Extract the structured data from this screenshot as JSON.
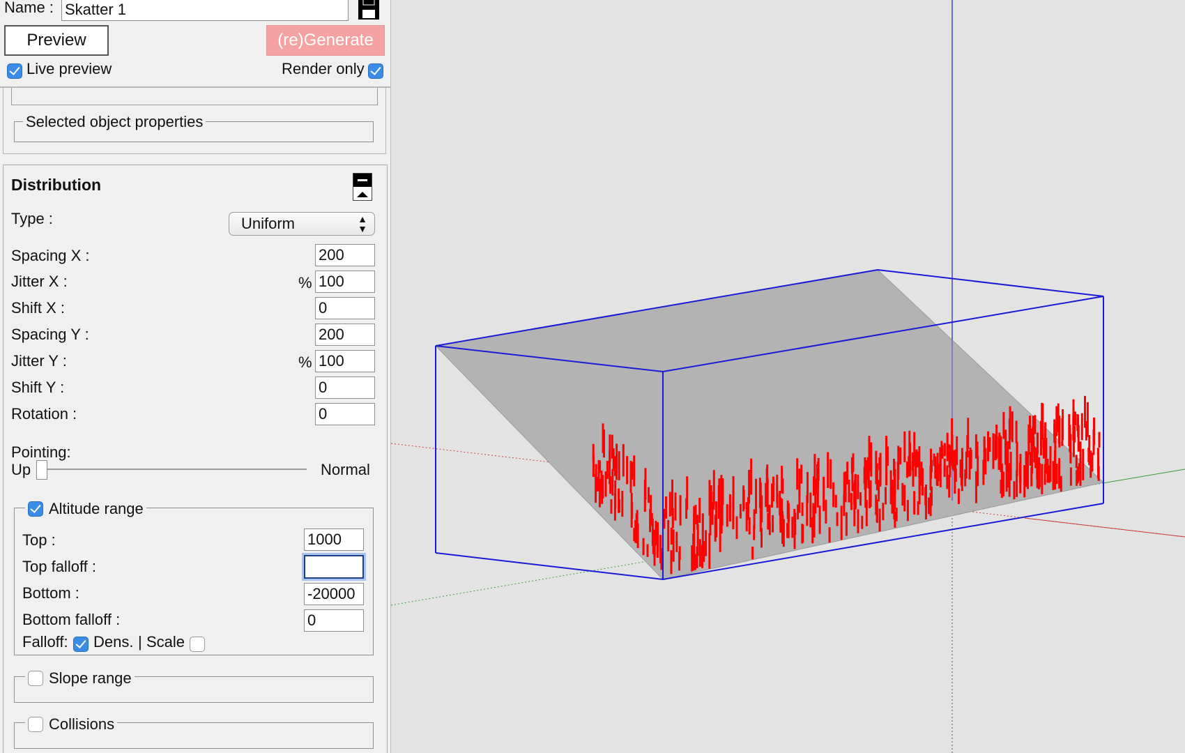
{
  "header": {
    "name_label": "Name :",
    "name_value": "Skatter 1",
    "save_icon": "floppy-disk-icon",
    "preview_label": "Preview",
    "generate_label": "(re)Generate",
    "generate_color": "#f4a2a2",
    "live_preview_label": "Live preview",
    "live_preview_checked": true,
    "render_only_label": "Render only",
    "render_only_checked": true
  },
  "selected_props": {
    "legend": "Selected object properties"
  },
  "distribution": {
    "title": "Distribution",
    "collapse_icon": "collapse-icon",
    "type_label": "Type :",
    "type_value": "Uniform",
    "spacing_x_label": "Spacing X :",
    "spacing_x": "200",
    "jitter_x_label": "Jitter X :",
    "jitter_x_unit": "%",
    "jitter_x": "100",
    "shift_x_label": "Shift X :",
    "shift_x": "0",
    "spacing_y_label": "Spacing Y :",
    "spacing_y": "200",
    "jitter_y_label": "Jitter Y :",
    "jitter_y_unit": "%",
    "jitter_y": "100",
    "shift_y_label": "Shift Y :",
    "shift_y": "0",
    "rotation_label": "Rotation :",
    "rotation": "0",
    "pointing_label": "Pointing:",
    "pointing_left": "Up",
    "pointing_right": "Normal",
    "pointing_value": 0
  },
  "altitude": {
    "legend": "Altitude range",
    "checked": true,
    "top_label": "Top :",
    "top": "1000",
    "top_falloff_label": "Top falloff :",
    "top_falloff": "",
    "bottom_label": "Bottom :",
    "bottom": "-20000",
    "bottom_falloff_label": "Bottom falloff :",
    "bottom_falloff": "0",
    "falloff_label": "Falloff:",
    "dens_label": "Dens.",
    "dens_checked": true,
    "separator": "|",
    "scale_label": "Scale",
    "scale_checked": false
  },
  "slope": {
    "legend": "Slope range",
    "checked": false
  },
  "collisions": {
    "legend": "Collisions",
    "checked": false
  },
  "viewport": {
    "bbox_color": "#1a1ad6",
    "instance_color": "#ff0000",
    "surface_color": "#b3b3b3"
  }
}
